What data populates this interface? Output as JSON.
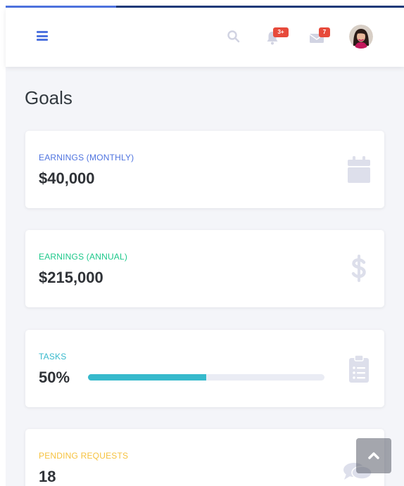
{
  "colors": {
    "primary": "#4e73df",
    "success": "#1cc88a",
    "info": "#36b9cc",
    "warning": "#f6c23e",
    "danger": "#e74a3b",
    "icon_muted": "#dddfeb"
  },
  "topbar": {
    "menu_icon": "hamburger-icon",
    "search_icon": "search-icon",
    "alerts": {
      "icon": "bell-icon",
      "badge": "3+"
    },
    "messages": {
      "icon": "envelope-icon",
      "badge": "7"
    },
    "avatar_icon": "user-avatar"
  },
  "page": {
    "title": "Goals"
  },
  "cards": [
    {
      "label": "Earnings (Monthly)",
      "value": "$40,000",
      "icon": "calendar-icon",
      "color": "#4e73df"
    },
    {
      "label": "Earnings (Annual)",
      "value": "$215,000",
      "icon": "dollar-icon",
      "color": "#1cc88a"
    },
    {
      "label": "Tasks",
      "value": "50%",
      "progress": 0.5,
      "icon": "clipboard-list-icon",
      "color": "#36b9cc"
    },
    {
      "label": "Pending Requests",
      "value": "18",
      "icon": "comments-icon",
      "color": "#f6c23e"
    }
  ],
  "scroll_to_top": {
    "icon": "chevron-up-icon"
  }
}
